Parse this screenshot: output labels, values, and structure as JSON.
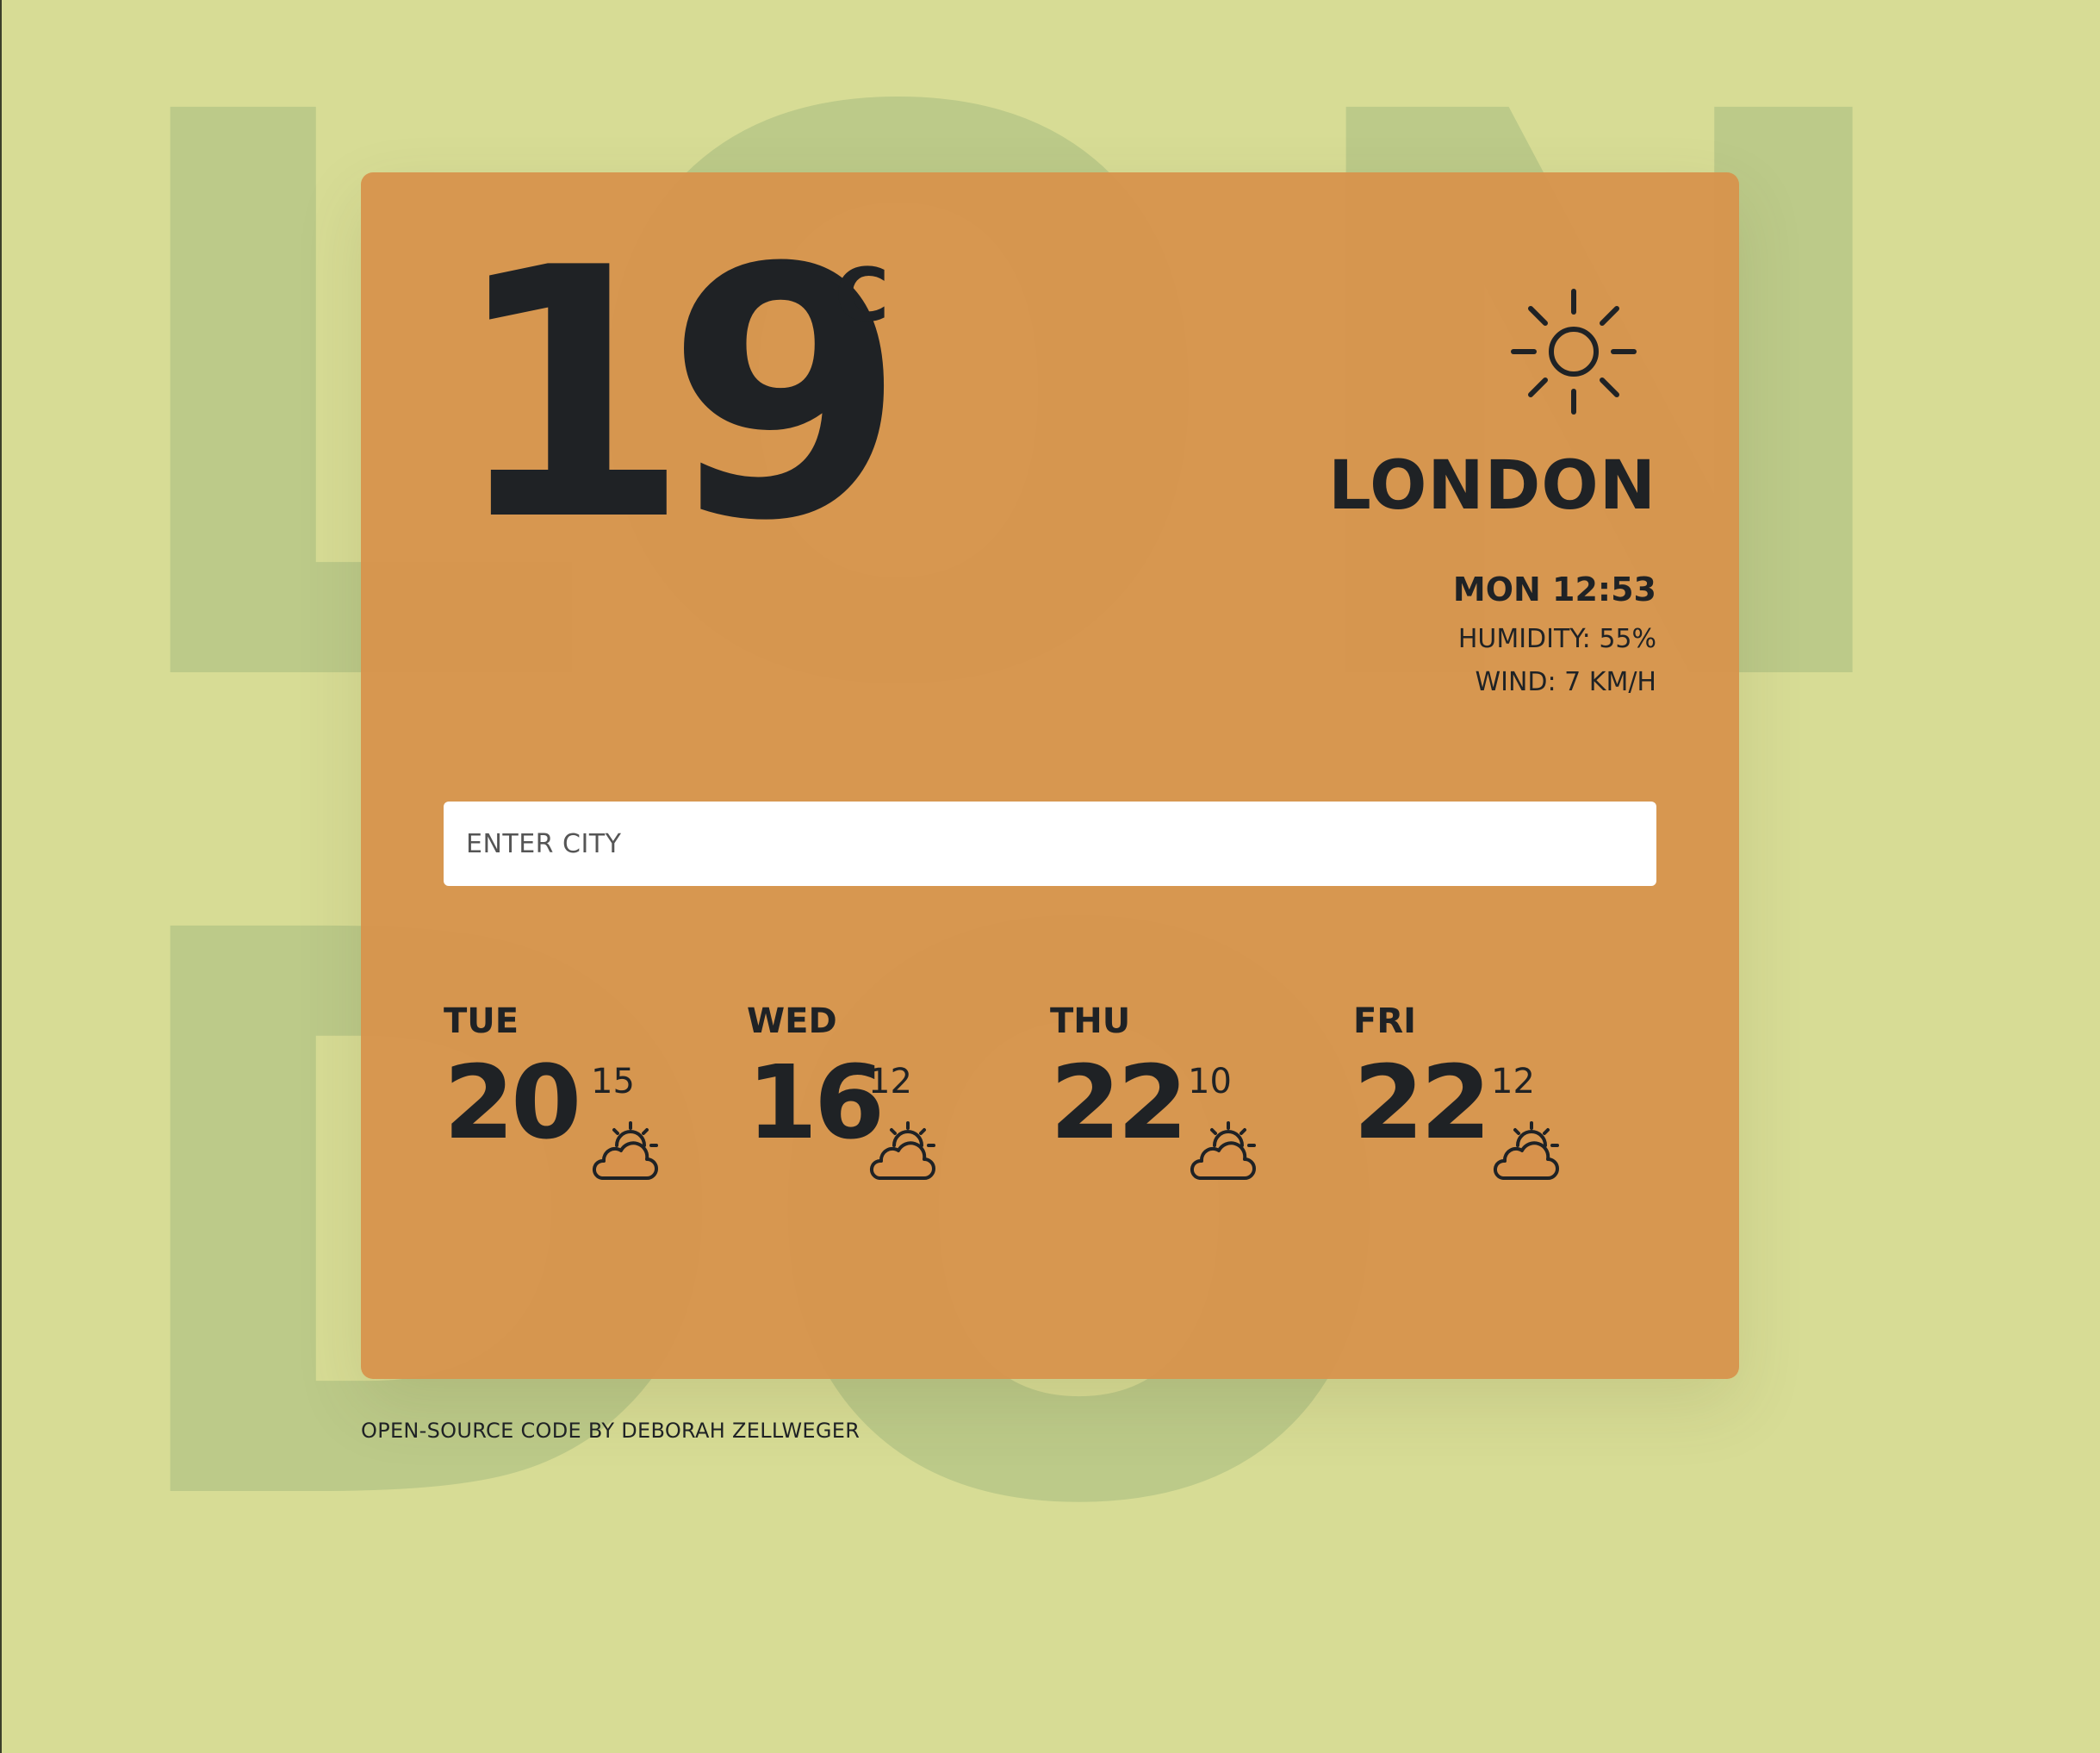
{
  "background": {
    "letters": [
      "L",
      "O",
      "N",
      "D",
      "O"
    ],
    "color": "#bcca89",
    "page_color": "#d7dc95"
  },
  "card": {
    "color": "#d7924c"
  },
  "current": {
    "temperature": "19",
    "unit": "C",
    "icon": "sun-icon",
    "city": "LONDON",
    "datetime": "MON 12:53",
    "humidity": "HUMIDITY: 55%",
    "wind": "WIND: 7 KM/H"
  },
  "search": {
    "placeholder": "ENTER CITY",
    "value": ""
  },
  "forecast": [
    {
      "day": "TUE",
      "high": "20",
      "low": "15",
      "icon": "partly-cloudy-icon"
    },
    {
      "day": "WED",
      "high": "16",
      "low": "12",
      "icon": "partly-cloudy-icon"
    },
    {
      "day": "THU",
      "high": "22",
      "low": "10",
      "icon": "partly-cloudy-icon"
    },
    {
      "day": "FRI",
      "high": "22",
      "low": "12",
      "icon": "partly-cloudy-icon"
    }
  ],
  "footer": {
    "credit": "OPEN-SOURCE CODE BY DEBORAH ZELLWEGER"
  }
}
